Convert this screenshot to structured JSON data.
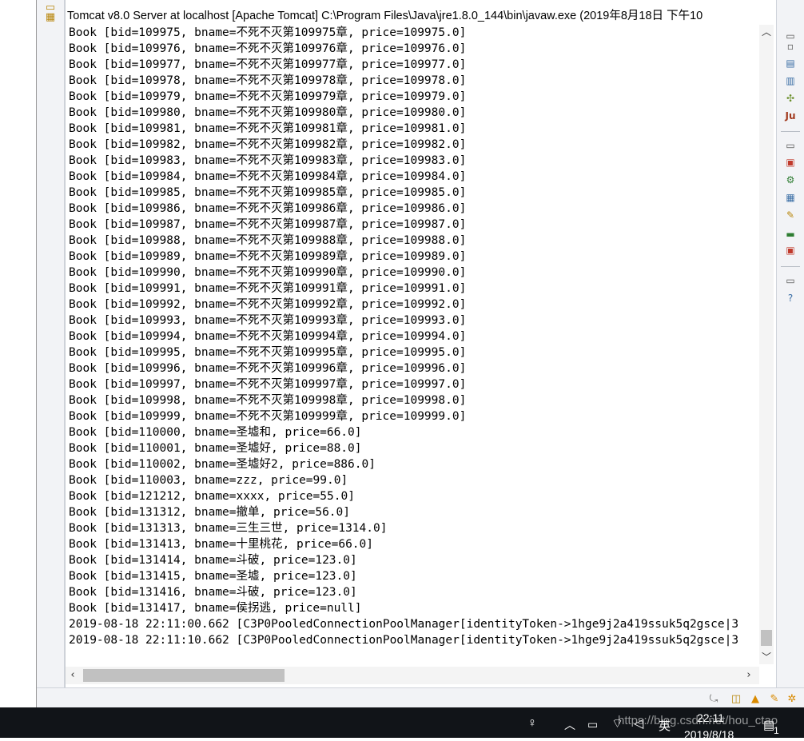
{
  "console": {
    "title": "Tomcat v8.0 Server at localhost [Apache Tomcat] C:\\Program Files\\Java\\jre1.8.0_144\\bin\\javaw.exe (2019年8月18日 下午10",
    "lines": [
      "Book [bid=109975, bname=不死不灭第109975章, price=109975.0]",
      "Book [bid=109976, bname=不死不灭第109976章, price=109976.0]",
      "Book [bid=109977, bname=不死不灭第109977章, price=109977.0]",
      "Book [bid=109978, bname=不死不灭第109978章, price=109978.0]",
      "Book [bid=109979, bname=不死不灭第109979章, price=109979.0]",
      "Book [bid=109980, bname=不死不灭第109980章, price=109980.0]",
      "Book [bid=109981, bname=不死不灭第109981章, price=109981.0]",
      "Book [bid=109982, bname=不死不灭第109982章, price=109982.0]",
      "Book [bid=109983, bname=不死不灭第109983章, price=109983.0]",
      "Book [bid=109984, bname=不死不灭第109984章, price=109984.0]",
      "Book [bid=109985, bname=不死不灭第109985章, price=109985.0]",
      "Book [bid=109986, bname=不死不灭第109986章, price=109986.0]",
      "Book [bid=109987, bname=不死不灭第109987章, price=109987.0]",
      "Book [bid=109988, bname=不死不灭第109988章, price=109988.0]",
      "Book [bid=109989, bname=不死不灭第109989章, price=109989.0]",
      "Book [bid=109990, bname=不死不灭第109990章, price=109990.0]",
      "Book [bid=109991, bname=不死不灭第109991章, price=109991.0]",
      "Book [bid=109992, bname=不死不灭第109992章, price=109992.0]",
      "Book [bid=109993, bname=不死不灭第109993章, price=109993.0]",
      "Book [bid=109994, bname=不死不灭第109994章, price=109994.0]",
      "Book [bid=109995, bname=不死不灭第109995章, price=109995.0]",
      "Book [bid=109996, bname=不死不灭第109996章, price=109996.0]",
      "Book [bid=109997, bname=不死不灭第109997章, price=109997.0]",
      "Book [bid=109998, bname=不死不灭第109998章, price=109998.0]",
      "Book [bid=109999, bname=不死不灭第109999章, price=109999.0]",
      "Book [bid=110000, bname=圣墟和, price=66.0]",
      "Book [bid=110001, bname=圣墟好, price=88.0]",
      "Book [bid=110002, bname=圣墟好2, price=886.0]",
      "Book [bid=110003, bname=zzz, price=99.0]",
      "Book [bid=121212, bname=xxxx, price=55.0]",
      "Book [bid=131312, bname=撤单, price=56.0]",
      "Book [bid=131313, bname=三生三世, price=1314.0]",
      "Book [bid=131413, bname=十里桃花, price=66.0]",
      "Book [bid=131414, bname=斗破, price=123.0]",
      "Book [bid=131415, bname=圣墟, price=123.0]",
      "Book [bid=131416, bname=斗破, price=123.0]",
      "Book [bid=131417, bname=侯拐逃, price=null]",
      "2019-08-18 22:11:00.662 [C3P0PooledConnectionPoolManager[identityToken->1hge9j2a419ssuk5q2gsce|3",
      "2019-08-18 22:11:10.662 [C3P0PooledConnectionPoolManager[identityToken->1hge9j2a419ssuk5q2gsce|3"
    ]
  },
  "taskbar": {
    "time": "22:11",
    "date": "2019/8/18",
    "ime": "英",
    "notification_count": "1",
    "watermark": "https://blog.csdn.net/hou_ctao"
  },
  "colors": {
    "taskbar": "#111418",
    "toolbar": "#f2f3f6",
    "scroll_thumb": "#c1c1c1"
  }
}
